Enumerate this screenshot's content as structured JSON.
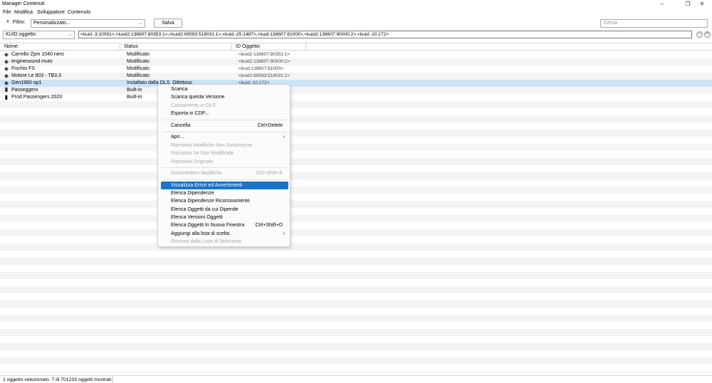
{
  "window": {
    "title": "Manager Contenuti",
    "controls": [
      "–",
      "❐",
      "✕"
    ]
  },
  "menu": [
    "File",
    "Modifica",
    "Sviluppatore",
    "Contenuto"
  ],
  "filter": {
    "label": "Filtro:",
    "value": "Personalizzato...",
    "save_label": "Salva",
    "search_placeholder": "Cerca"
  },
  "kuid": {
    "field_type": "KUID oggetto",
    "value": "<kuid:-3:10091>,<kuid2:138607:80353:1>,<kuid2:69593:518031:1>,<kuid:-25:1487>,<kuid:138607:81000>,<kuid2:138607:90000:2>,<kuid:-10:172>",
    "minus": "−",
    "plus": "+"
  },
  "columns": {
    "name": "Nome:",
    "status": "Status",
    "id": "ID Oggetto"
  },
  "rows": [
    {
      "icon": "traincar-icon",
      "glyph": "◈",
      "name": "Carrello Zpm 1040 nero",
      "status": "Modificato",
      "kuid": "<kuid2:138607:80353:1>"
    },
    {
      "icon": "traincar-icon",
      "glyph": "◈",
      "name": "enginesound muto",
      "status": "Modificato",
      "kuid": "<kuid2:138607:90000:2>"
    },
    {
      "icon": "traincar-icon",
      "glyph": "◈",
      "name": "Fischio FS",
      "status": "Modificato",
      "kuid": "<kuid:138607:81000>"
    },
    {
      "icon": "traincar-icon",
      "glyph": "◈",
      "name": "Motore Le 803 - TB3.3",
      "status": "Modificato",
      "kuid": "<kuid2:69593:518031:1>"
    },
    {
      "icon": "traincar-icon",
      "glyph": "◈",
      "name": "Gen1960 op1",
      "status": "Installato dalla DLS, Difettoso",
      "kuid": "<kuid:-10:172>"
    },
    {
      "icon": "passenger-icon",
      "glyph": "♜",
      "name": "Passeggero",
      "status": "Built-in",
      "kuid": ""
    },
    {
      "icon": "book-icon",
      "glyph": "▮",
      "name": "Prod Passengers 2020",
      "status": "Built-in",
      "kuid": ""
    }
  ],
  "context_menu": [
    {
      "label": "Scarica",
      "state": "normal"
    },
    {
      "label": "Scarica questa Versione",
      "state": "normal"
    },
    {
      "label": "Caricamento in DLS",
      "state": "disabled"
    },
    {
      "label": "Esporta in CDP...",
      "state": "normal"
    },
    {
      "divider": true
    },
    {
      "label": "Cancella",
      "shortcut": "Ctrl+Delete",
      "state": "normal"
    },
    {
      "divider": true
    },
    {
      "label": "Apri...",
      "submenu": true,
      "state": "normal"
    },
    {
      "label": "Ripristina Modifiche Non Sottomesse",
      "state": "disabled"
    },
    {
      "label": "Ripristina Se Non Modificate",
      "state": "disabled"
    },
    {
      "label": "Ripristina Originale",
      "state": "disabled"
    },
    {
      "divider": true
    },
    {
      "label": "Sottomettere Modifiche",
      "shortcut": "Ctrl+Shift+E",
      "state": "disabled"
    },
    {
      "divider": true
    },
    {
      "label": "Visualizza Errori ed Avvertimenti",
      "state": "highlighted"
    },
    {
      "label": "Elenca Dipendenze",
      "state": "normal"
    },
    {
      "label": "Elenca Dipendenze Ricorsivamente",
      "state": "normal"
    },
    {
      "label": "Elenca Oggetti da cui Dipende",
      "state": "normal"
    },
    {
      "label": "Elenca Versioni Oggetti",
      "state": "normal"
    },
    {
      "label": "Elenca Oggetti In Nuova Finestra",
      "shortcut": "Ctrl+Shift+O",
      "state": "normal"
    },
    {
      "label": "Aggiungi alla lista di scelta",
      "submenu": true,
      "state": "normal"
    },
    {
      "label": "Rimuovi dalla Lista di Selezione",
      "state": "disabled"
    }
  ],
  "status": {
    "text": "1 oggetto selezionato. 7 di 701233 oggetti mostrati."
  },
  "colors": {
    "selection": "#cde4f7",
    "highlight": "#1a73c8"
  }
}
